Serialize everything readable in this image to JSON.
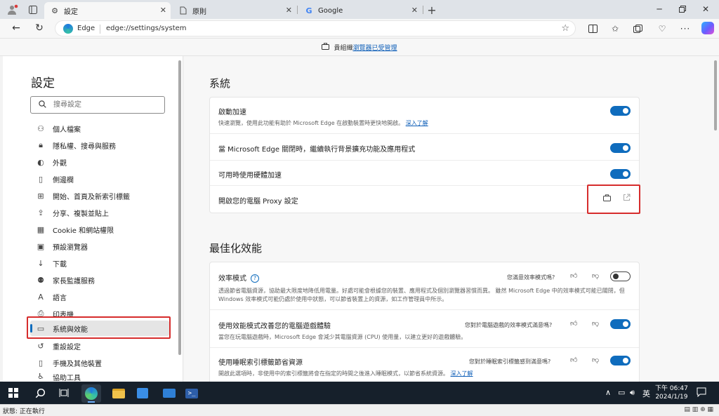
{
  "tabs": [
    {
      "label": "設定",
      "icon": "gear-icon"
    },
    {
      "label": "原則",
      "icon": "page-icon"
    },
    {
      "label": "Google",
      "icon": "google-icon"
    }
  ],
  "address": {
    "site_label": "Edge",
    "url": "edge://settings/system"
  },
  "managed_bar": {
    "prefix": "貴組織",
    "link": "瀏覽器已受管理"
  },
  "sidebar": {
    "title": "設定",
    "search_placeholder": "搜尋設定",
    "items": [
      {
        "label": "個人檔案",
        "icon": "profile-icon"
      },
      {
        "label": "隱私權、搜尋與服務",
        "icon": "lock-icon"
      },
      {
        "label": "外觀",
        "icon": "appearance-icon"
      },
      {
        "label": "側邊欄",
        "icon": "sidebar-icon"
      },
      {
        "label": "開始、首頁及新索引標籤",
        "icon": "home-icon"
      },
      {
        "label": "分享、複製並貼上",
        "icon": "share-icon"
      },
      {
        "label": "Cookie 和網站權限",
        "icon": "cookie-icon"
      },
      {
        "label": "預設瀏覽器",
        "icon": "browser-icon"
      },
      {
        "label": "下載",
        "icon": "download-icon"
      },
      {
        "label": "家長監護服務",
        "icon": "family-icon"
      },
      {
        "label": "語言",
        "icon": "language-icon"
      },
      {
        "label": "印表機",
        "icon": "printer-icon"
      },
      {
        "label": "系統與效能",
        "icon": "system-icon",
        "selected": true
      },
      {
        "label": "重設設定",
        "icon": "reset-icon"
      },
      {
        "label": "手機及其他裝置",
        "icon": "phone-icon"
      },
      {
        "label": "協助工具",
        "icon": "accessibility-icon"
      }
    ]
  },
  "system_section": {
    "title": "系統",
    "rows": [
      {
        "title": "啟動加速",
        "desc": "快速瀏覽，使用此功能有助於 Microsoft Edge 在啟動裝置時更快地開啟。",
        "link": "深入了解",
        "toggle": true
      },
      {
        "title": "當 Microsoft Edge 關閉時，繼續執行背景擴充功能及應用程式",
        "toggle": true
      },
      {
        "title": "可用時使用硬體加速",
        "toggle": true
      },
      {
        "title": "開啟您的電腦 Proxy 設定"
      }
    ]
  },
  "performance_section": {
    "title": "最佳化效能",
    "rows": [
      {
        "title": "效率模式",
        "feedback": "您滿意效率模式嗎?",
        "desc": "透過節省電腦資源，協助最大限度地降低用電量。好處可能會根據您的裝置、應用程式及個別瀏覽器習慣而異。 雖然 Microsoft Edge 中的效率模式可能已關閉，但 Windows 效率模式可能仍處於使用中狀態，可以節省裝置上的資源，如工作管理員中所示。",
        "toggle": false
      },
      {
        "title": "使用效能模式改善您的電腦遊戲體驗",
        "feedback": "您對於電腦遊戲的效率模式滿意嗎?",
        "desc": "當您在玩電腦遊戲時，Microsoft Edge 會減少其電腦資源 (CPU) 使用量，以建立更好的遊戲體驗。",
        "toggle": true
      },
      {
        "title": "使用睡眠索引標籤節省資源",
        "feedback": "您對於睡眠索引標籤感到滿意嗎?",
        "desc": "開啟此選項時，非使用中的索引標籤將會在指定的時間之後進入睡眠模式，以節省系統資源。",
        "link": "深入了解",
        "toggle": true
      }
    ]
  },
  "taskbar": {
    "ime": "英",
    "time": "下午 06:47",
    "date": "2024/1/19"
  },
  "status": {
    "text": "狀態: 正在執行"
  }
}
